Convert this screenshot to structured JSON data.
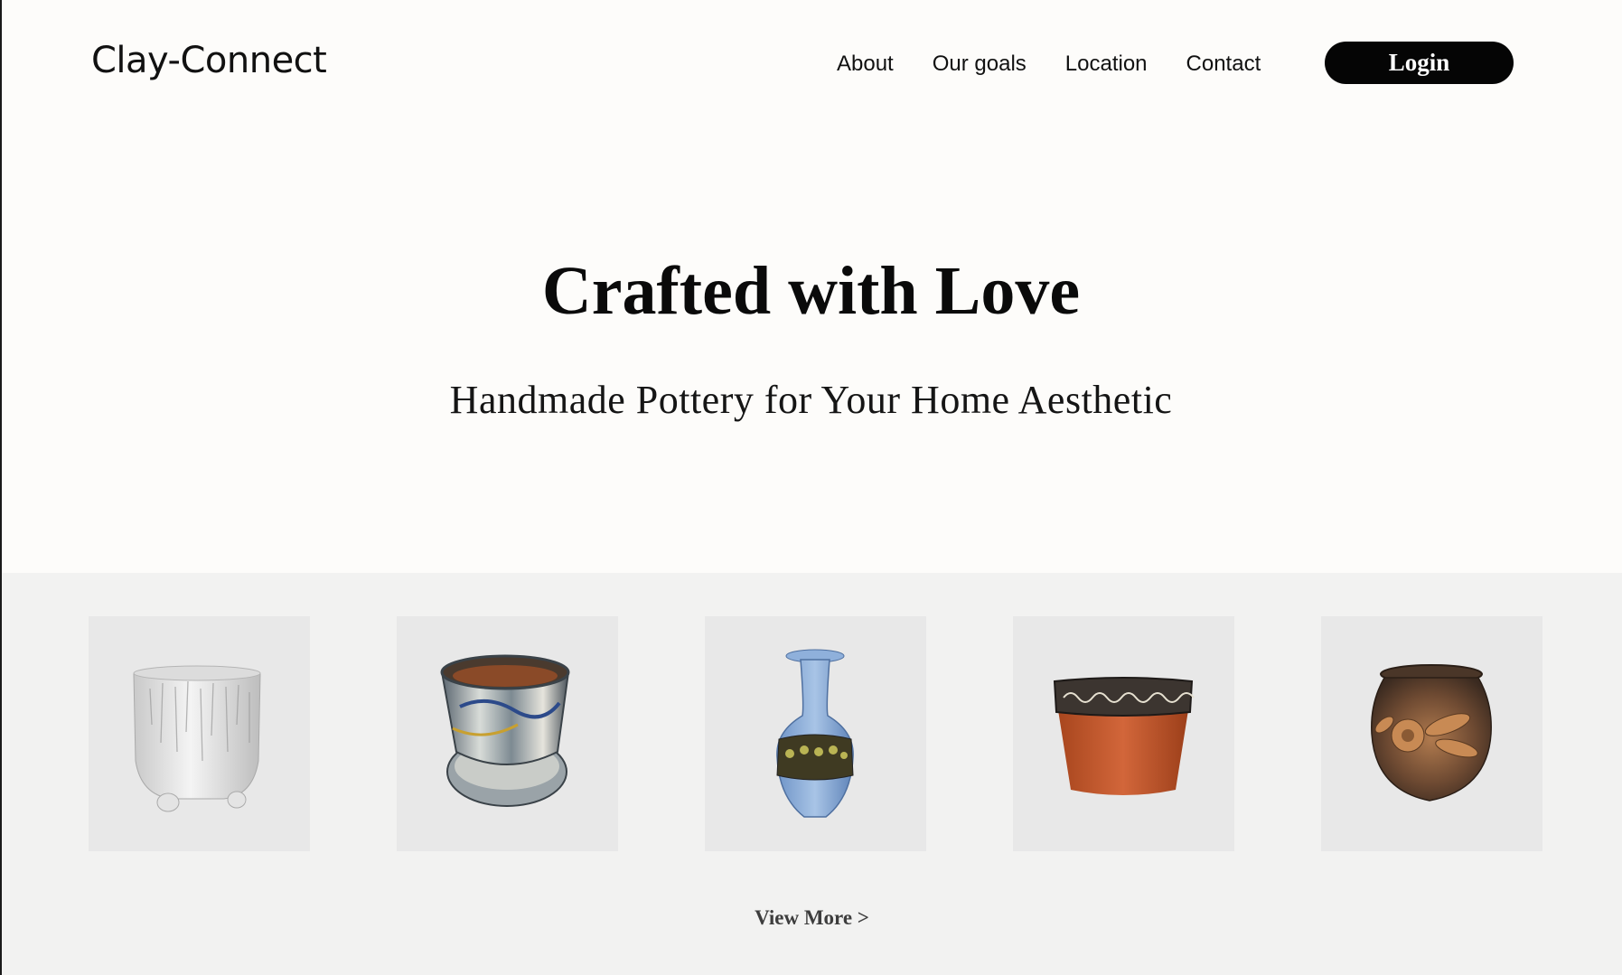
{
  "header": {
    "logo": "Clay-Connect",
    "nav": [
      "About",
      "Our goals",
      "Location",
      "Contact"
    ],
    "login_label": "Login"
  },
  "hero": {
    "title": "Crafted with Love",
    "subtitle": "Handmade Pottery for Your Home Aesthetic"
  },
  "gallery": {
    "items": [
      {
        "icon": "white-textured-footed-planter-image"
      },
      {
        "icon": "marbled-pot-with-saucer-image"
      },
      {
        "icon": "blue-vase-image"
      },
      {
        "icon": "terracotta-pot-with-patterned-rim-image"
      },
      {
        "icon": "bronze-floral-relief-jar-image"
      }
    ],
    "view_more_label": "View More >"
  },
  "colors": {
    "page_background": "#fdfcfa",
    "gallery_background": "#f2f2f1",
    "card_background": "#e8e8e8",
    "button_background": "#050505",
    "button_text": "#ffffff"
  }
}
